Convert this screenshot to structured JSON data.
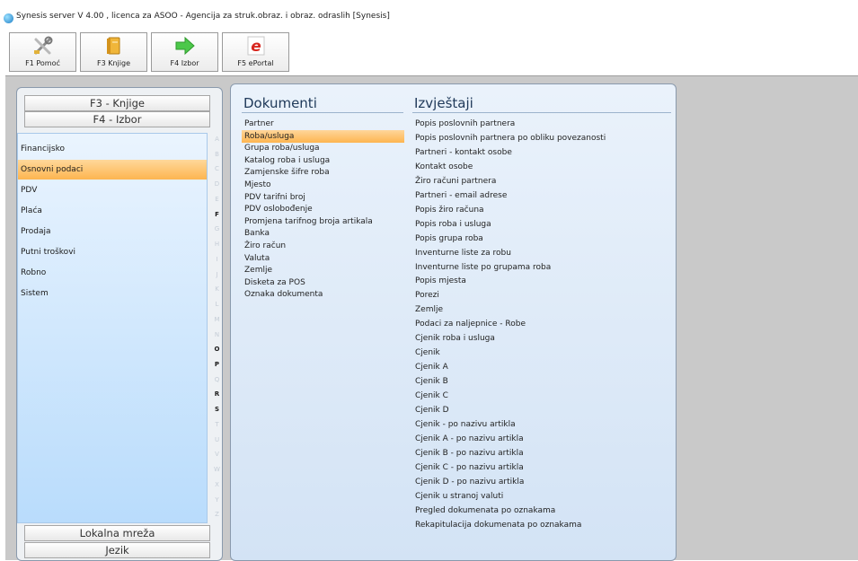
{
  "window": {
    "title": "Synesis server V 4.00 , licenca za ASOO - Agencija za struk.obraz. i obraz. odraslih   [Synesis]"
  },
  "toolbar": {
    "buttons": [
      {
        "label": "F1 Pomoć",
        "icon": "tools-icon"
      },
      {
        "label": "F3 Knjige",
        "icon": "book-icon"
      },
      {
        "label": "F4 Izbor",
        "icon": "arrow-right-icon"
      },
      {
        "label": "F5 ePortal",
        "icon": "eportal-icon"
      }
    ]
  },
  "left_panel": {
    "header_books": "F3 - Knjige",
    "header_select": "F4 - Izbor",
    "footer_network": "Lokalna mreža",
    "footer_language": "Jezik",
    "menu": [
      {
        "label": "Financijsko"
      },
      {
        "label": "Osnovni podaci",
        "selected": true
      },
      {
        "label": "PDV"
      },
      {
        "label": "Plaća"
      },
      {
        "label": "Prodaja"
      },
      {
        "label": "Putni troškovi"
      },
      {
        "label": "Robno"
      },
      {
        "label": "Sistem"
      }
    ],
    "alphabet": [
      "A",
      "B",
      "C",
      "D",
      "E",
      "F",
      "G",
      "H",
      "I",
      "J",
      "K",
      "L",
      "M",
      "N",
      "O",
      "P",
      "Q",
      "R",
      "S",
      "T",
      "U",
      "V",
      "W",
      "X",
      "Y",
      "Z"
    ],
    "alphabet_active": [
      "F",
      "O",
      "P",
      "R",
      "S"
    ]
  },
  "documents": {
    "title": "Dokumenti",
    "items": [
      "Partner",
      "Roba/usluga",
      "Grupa roba/usluga",
      "Katalog roba i usluga",
      "Zamjenske šifre roba",
      "Mjesto",
      "PDV tarifni broj",
      "PDV oslobođenje",
      "Promjena tarifnog broja artikala",
      "Banka",
      "Žiro račun",
      "Valuta",
      "Zemlje",
      "Disketa za POS",
      "Oznaka dokumenta"
    ],
    "selected_index": 1
  },
  "reports": {
    "title": "Izvještaji",
    "items": [
      "Popis poslovnih partnera",
      "Popis poslovnih partnera po obliku povezanosti",
      "Partneri - kontakt osobe",
      "Kontakt osobe",
      "Žiro računi partnera",
      "Partneri - email adrese",
      "Popis žiro računa",
      "Popis roba i usluga",
      "Popis grupa roba",
      "Inventurne liste za robu",
      "Inventurne liste po grupama roba",
      "Popis mjesta",
      "Porezi",
      "Zemlje",
      "Podaci za naljepnice - Robe",
      "Cjenik roba i usluga",
      "Cjenik",
      "Cjenik A",
      "Cjenik B",
      "Cjenik C",
      "Cjenik D",
      "Cjenik - po nazivu artikla",
      "Cjenik A - po nazivu artikla",
      "Cjenik B - po nazivu artikla",
      "Cjenik C - po nazivu artikla",
      "Cjenik D - po nazivu artikla",
      "Cjenik u stranoj valuti",
      "Pregled dokumenata po oznakama",
      "Rekapitulacija dokumenata po oznakama"
    ]
  },
  "colors": {
    "selection": "#fdb550",
    "menu_bg": "#cfe6fd",
    "workspace": "#c9c9c9"
  }
}
